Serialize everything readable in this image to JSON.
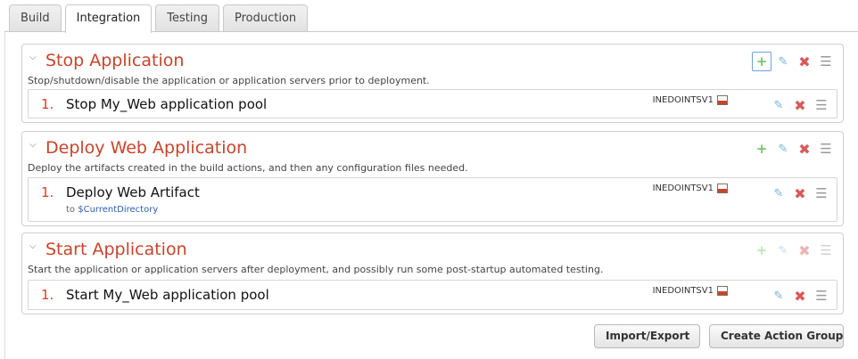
{
  "tabs": [
    {
      "label": "Build",
      "active": false
    },
    {
      "label": "Integration",
      "active": true
    },
    {
      "label": "Testing",
      "active": false
    },
    {
      "label": "Production",
      "active": false
    }
  ],
  "groups": [
    {
      "title": "Stop Application",
      "description": "Stop/shutdown/disable the application or application servers prior to deployment.",
      "actions": [
        {
          "number": "1.",
          "name": "Stop My_Web application pool",
          "server": "INEDOINTSV1"
        }
      ]
    },
    {
      "title": "Deploy Web Application",
      "description": "Deploy the artifacts created in the build actions, and then any configuration files needed.",
      "actions": [
        {
          "number": "1.",
          "name": "Deploy Web Artifact",
          "sub_prefix": "to",
          "sub_var": "$CurrentDirectory",
          "server": "INEDOINTSV1"
        }
      ]
    },
    {
      "title": "Start Application",
      "description": "Start the application or application servers after deployment, and possibly run some post-startup automated testing.",
      "actions": [
        {
          "number": "1.",
          "name": "Start My_Web application pool",
          "server": "INEDOINTSV1"
        }
      ]
    }
  ],
  "icons": {
    "add": "plus-icon",
    "edit": "pencil-icon",
    "delete": "x-icon",
    "drag": "drag-handle-icon"
  },
  "colors": {
    "title": "#c8442b",
    "add": "#7cc36a",
    "edit": "#73b4d6",
    "delete": "#d9595b"
  },
  "buttons": {
    "import_export": "Import/Export",
    "create_group": "Create Action Group"
  }
}
